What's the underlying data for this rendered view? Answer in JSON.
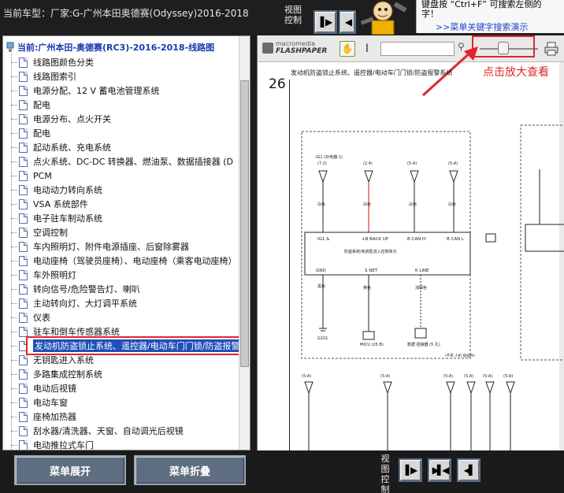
{
  "topbar": {
    "car_title": "当前车型：厂家:G-广州本田奥德赛(Odyssey)2016-2018",
    "view_control_label": "视图控制",
    "hint_line1": "键盘按 “Ctrl+F” 可搜索左侧的",
    "hint_line2": "字！",
    "hint_link": ">>菜单关键字搜索演示"
  },
  "sidebar": {
    "root_label": "当前:广州本田-奥德赛(RC3)-2016-2018-线路图",
    "items": [
      {
        "label": "线路图颜色分类"
      },
      {
        "label": "线路图索引"
      },
      {
        "label": "电源分配、12 V 蓄电池管理系统"
      },
      {
        "label": "配电"
      },
      {
        "label": "电源分布、点火开关"
      },
      {
        "label": "配电"
      },
      {
        "label": "起动系统、充电系统"
      },
      {
        "label": "点火系统、DC-DC 转换器、燃油泵、数据插接器 (D"
      },
      {
        "label": "PCM"
      },
      {
        "label": "电动动力转向系统"
      },
      {
        "label": "VSA 系统部件"
      },
      {
        "label": "电子驻车制动系统"
      },
      {
        "label": "空调控制"
      },
      {
        "label": "车内照明灯、附件电源插座、后窗除雾器"
      },
      {
        "label": "电动座椅（驾驶员座椅）、电动座椅（乘客电动座椅）"
      },
      {
        "label": "车外照明灯"
      },
      {
        "label": "转向信号/危险警告灯、喇叭"
      },
      {
        "label": "主动转向灯、大灯调平系统"
      },
      {
        "label": "仪表"
      },
      {
        "label": "驻车和倒车传感器系统"
      },
      {
        "label": "发动机防盗锁止系统、遥控器/电动车门门锁/防盗报警"
      },
      {
        "label": "无钥匙进入系统"
      },
      {
        "label": "多路集成控制系统"
      },
      {
        "label": "电动后视镜"
      },
      {
        "label": "电动车窗"
      },
      {
        "label": "座椅加热器"
      },
      {
        "label": "刮水器/清洗器、天窗、自动调光后视镜"
      },
      {
        "label": "电动推拉式车门"
      }
    ],
    "selected_index": 20
  },
  "bottombar": {
    "expand_label": "菜单展开",
    "collapse_label": "菜单折叠",
    "view_control_label": "视图控制"
  },
  "viewer": {
    "logo_line1": "macromedia",
    "logo_line2": "FLASHPAPER",
    "zoom_hint": "点击放大查看",
    "page_number": "26",
    "doc_title": "发动机防盗锁止系统、遥控器/电动车门门锁/防盗报警系统",
    "zoom_level": 0.4,
    "accent_color": "#e0252a"
  },
  "diagram": {
    "connectors": [
      "IG1 (补电器 1)",
      "(7.2)",
      "(2.4)",
      "(5-A)",
      "(5-A)"
    ],
    "pins_top": [
      "IG1 &",
      "+B BACK UP",
      "B CAN H",
      "B CAN L"
    ],
    "module_name": "防盗系统/免钥匙进入控制单元",
    "pins_bottom": [
      "GND",
      "S NET",
      "K LINE"
    ],
    "wire_colors": [
      "白色",
      "白色",
      "白色",
      "白色",
      "黑色",
      "黄色",
      "浅绿色"
    ],
    "grounds": [
      "G101",
      "MICU (25 B)",
      "数据 插接器 (5 孔)"
    ],
    "note": "(不带 人机 接插件)",
    "bottom_labels": [
      "(5-A)",
      "(5-A)",
      "(5-A)",
      "(5-A)",
      "(5-A)",
      "(5-A)"
    ]
  }
}
